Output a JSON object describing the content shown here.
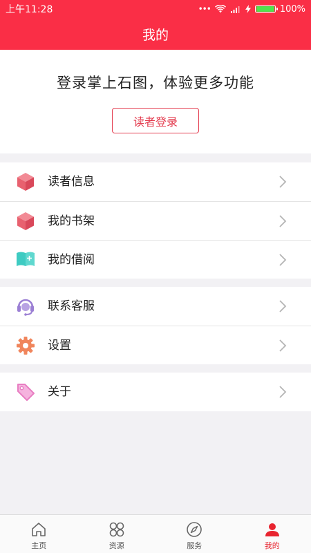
{
  "status_bar": {
    "time": "上午11:28",
    "signal_text": "...",
    "battery_percent": "100%"
  },
  "header": {
    "title": "我的"
  },
  "login": {
    "prompt": "登录掌上石图，体验更多功能",
    "button_label": "读者登录"
  },
  "menu_groups": [
    {
      "items": [
        {
          "label": "读者信息",
          "icon": "cube-icon",
          "color": "#e8616f"
        },
        {
          "label": "我的书架",
          "icon": "cube-icon",
          "color": "#e8616f"
        },
        {
          "label": "我的借阅",
          "icon": "book-add-icon",
          "color": "#3ecbc2"
        }
      ]
    },
    {
      "items": [
        {
          "label": "联系客服",
          "icon": "headset-icon",
          "color": "#9b7fd4"
        },
        {
          "label": "设置",
          "icon": "gear-icon",
          "color": "#f0855c"
        }
      ]
    },
    {
      "items": [
        {
          "label": "关于",
          "icon": "tag-icon",
          "color": "#e87ec2"
        }
      ]
    }
  ],
  "tabs": [
    {
      "label": "主页",
      "icon": "home-icon",
      "active": false
    },
    {
      "label": "资源",
      "icon": "grid-icon",
      "active": false
    },
    {
      "label": "服务",
      "icon": "compass-icon",
      "active": false
    },
    {
      "label": "我的",
      "icon": "person-icon",
      "active": true
    }
  ],
  "colors": {
    "accent": "#fa2e46",
    "button_border": "#e33b4e",
    "tab_active": "#e8242f"
  }
}
